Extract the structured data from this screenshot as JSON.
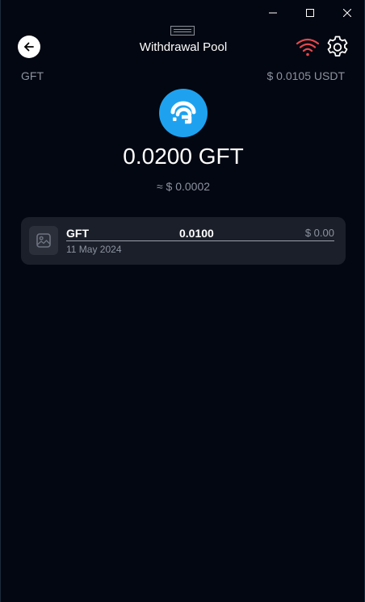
{
  "window": {
    "minimize_symbol": "—",
    "maximize_symbol": "☐",
    "close_symbol": "✕"
  },
  "header": {
    "title": "Withdrawal Pool",
    "back_icon": "arrow-left-icon",
    "wifi_icon": "wifi-icon",
    "settings_icon": "gear-icon",
    "wifi_color": "#e5484d"
  },
  "token": {
    "symbol": "GFT",
    "price": "$ 0.0105 USDT",
    "logo_color": "#1ea2f0",
    "balance": "0.0200 GFT",
    "balance_usd": "≈ $ 0.0002"
  },
  "transactions": [
    {
      "name": "GFT",
      "amount": "0.0100",
      "usd": "$ 0.00",
      "date": "11 May 2024",
      "icon": "image-placeholder-icon"
    }
  ]
}
